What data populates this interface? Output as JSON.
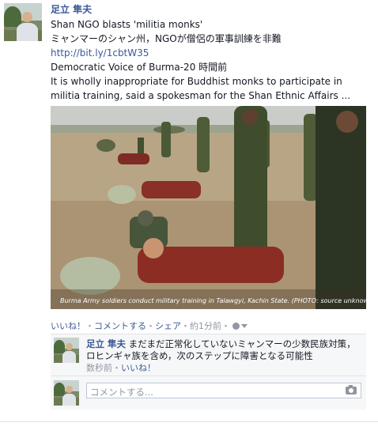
{
  "post": {
    "author": "足立 隼夫",
    "title_en": "Shan NGO blasts 'militia monks'",
    "title_ja": "ミャンマーのシャン州，NGOが僧侶の軍事訓練を非難",
    "link": "http://bit.ly/1cbtW35",
    "source": "Democratic Voice of Burma-20 時間前",
    "excerpt": "It is wholly inappropriate for Buddhist monks to participate in militia training, said a spokesman for the Shan Ethnic Affairs ...",
    "photo_caption": "Burma Army soldiers conduct military training in Talawgyi, Kachin State. (PHOTO: source unknown)"
  },
  "actions": {
    "like": "いいね！",
    "sep1": "・",
    "comment": "コメントする",
    "sep2": "・",
    "share": "シェア",
    "time": "・約1分前・"
  },
  "comment": {
    "author": "足立 隼夫",
    "text": "まだまだ正常化していないミャンマーの少数民族対策，ロヒンギャ族を含め，次のステップに障害となる可能性",
    "time": "数秒前・",
    "like": "いいね！"
  },
  "reply": {
    "placeholder": "コメントする..."
  },
  "icons": {
    "audience": "globe-icon",
    "audience_menu": "chevron-down-icon",
    "attach_photo": "camera-icon"
  },
  "colors": {
    "link": "#3b5998",
    "meta": "#9197a3",
    "comment_bg": "#f6f7f8"
  }
}
